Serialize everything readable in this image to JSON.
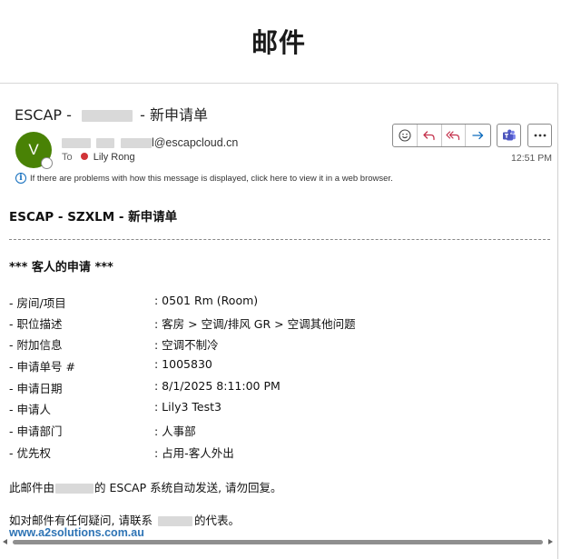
{
  "app": {
    "title": "邮件"
  },
  "message": {
    "subject_prefix": "ESCAP -",
    "subject_suffix": "- 新申请单",
    "sender_suffix": "l@escapcloud.cn",
    "to_label": "To",
    "recipient": "Lily Rong",
    "avatar_initial": "V",
    "timestamp": "12:51 PM",
    "info_text": "If there are problems with how this message is displayed, click here to view it in a web browser.",
    "colors": {
      "avatar": "#498205",
      "presence_busy": "#d13438",
      "link": "#2e74b5",
      "accent": "#0f6cbd"
    }
  },
  "toolbar": {
    "icons": [
      "smiley-icon",
      "reply-icon",
      "reply-all-icon",
      "forward-icon",
      "teams-icon",
      "more-icon"
    ]
  },
  "body": {
    "title": "ESCAP - SZXLM - 新申请单",
    "section_head": "*** 客人的申请 ***",
    "fields": [
      {
        "label": "- 房间/项目",
        "value": ": 0501 Rm (Room)"
      },
      {
        "label": "- 职位描述",
        "value": ": 客房 > 空调/排风 GR > 空调其他问题"
      },
      {
        "label": "- 附加信息",
        "value": ": 空调不制冷"
      },
      {
        "label": "- 申请单号 #",
        "value": ": 1005830"
      },
      {
        "label": "- 申请日期",
        "value": ": 8/1/2025 8:11:00 PM"
      },
      {
        "label": "- 申请人",
        "value": ": Lily3 Test3"
      },
      {
        "label": "- 申请部门",
        "value": ": 人事部"
      },
      {
        "label": "- 优先权",
        "value": ": 占用-客人外出"
      }
    ],
    "footer_1_prefix": "此邮件由",
    "footer_1_suffix": "的 ESCAP 系统自动发送, 请勿回复。",
    "footer_2_prefix": "如对邮件有任何疑问, 请联系",
    "footer_2_suffix": "的代表。",
    "footer_link": "www.a2solutions.com.au"
  }
}
